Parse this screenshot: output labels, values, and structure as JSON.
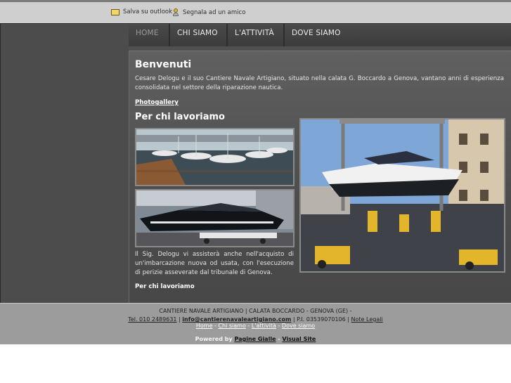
{
  "topbar": {
    "save_outlook": "Salva su outlook",
    "tell_friend": "Segnala ad un amico"
  },
  "nav": {
    "tabs": [
      {
        "label": "HOME",
        "active": true
      },
      {
        "label": "CHI SIAMO",
        "active": false
      },
      {
        "label": "L'ATTIVITÀ",
        "active": false
      },
      {
        "label": "DOVE SIAMO",
        "active": false
      }
    ]
  },
  "main": {
    "title": "Benvenuti",
    "intro": "Cesare Delogu e il suo Cantiere Navale Artigiano, situato nella calata G. Boccardo a Genova, vantano anni di esperienza consolidata nel settore della riparazione nautica.",
    "photogallery_link": "Photogallery",
    "subtitle": "Per chi lavoriamo",
    "paragraph": "Il Sig. Delogu vi assisterà anche nell'acquisto di un'imbarcazione nuova od usata, con l'esecuzione di perizie asseverate dal tribunale di Genova.",
    "bottom_link": "Per chi lavoriamo"
  },
  "footer": {
    "line1": "CANTIERE NAVALE ARTIGIANO | CALATA BOCCARDO - GENOVA (GE) -",
    "tel": "Tel. 010 2489631",
    "email": "info@cantierenavaleartigiano.com",
    "piva": "P.I. 03539070106",
    "legal": "Note Legali",
    "nav_links": [
      "Home",
      "Chi siamo",
      "L'attività",
      "Dove siamo"
    ],
    "powered_by": "Powered by",
    "provider1": "Pagine Gialle",
    "provider2": "Visual Site"
  },
  "colors": {
    "background": "#505050",
    "footer": "#9c9c9c",
    "accent_text": "#ffffff"
  }
}
